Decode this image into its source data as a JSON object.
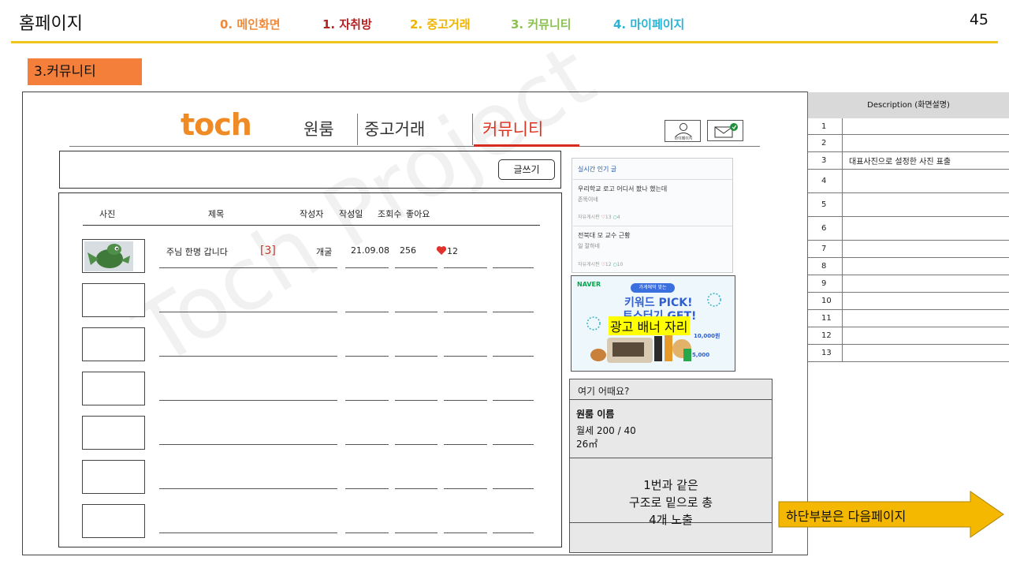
{
  "slide": {
    "title": "홈페이지",
    "page_number": "45",
    "section_tag": "3.커뮤니티",
    "nav": [
      {
        "label": "0. 메인화면",
        "color": "#f08a3a"
      },
      {
        "label": "1. 자취방",
        "color": "#b22222"
      },
      {
        "label": "2. 중고거래",
        "color": "#f0b400"
      },
      {
        "label": "3. 커뮤니티",
        "color": "#8cc152"
      },
      {
        "label": "4. 마이페이지",
        "color": "#2bb3d6"
      }
    ]
  },
  "app": {
    "logo": "toch",
    "menu": [
      "원룸",
      "중고거래",
      "커뮤니티"
    ],
    "my_button_label": "마이페이지",
    "write_button": "글쓰기"
  },
  "list": {
    "columns": [
      "사진",
      "제목",
      "작성자",
      "작성일",
      "조회수",
      "좋아요"
    ],
    "first_row": {
      "title": "주님 한명 갑니다",
      "reply_count": "[3]",
      "author": "개굴",
      "date": "21.09.08",
      "views": "256",
      "likes": "12"
    }
  },
  "popular": {
    "title": "실시간 인기 글",
    "items": [
      {
        "title": "우리학교 로고 어디서 봤나 했는데",
        "sub": "존똑이네",
        "board": "자유게시판",
        "likes": "13",
        "comments": "4"
      },
      {
        "title": "전북대 모 교수 근황",
        "sub": "일 잘하네",
        "board": "자유게시판",
        "likes": "12",
        "comments": "10"
      }
    ]
  },
  "ad": {
    "brand": "NAVER",
    "pill": "가게에딱 맞는",
    "headline1": "키워드 PICK!",
    "headline2": "토스터기 GET!",
    "label": "광고 배너 자리",
    "prize1": "10,000원",
    "prize2": "5,000"
  },
  "recommend": {
    "header": "여기 어때요?",
    "name": "원룸 이름",
    "price": "월세 200 / 40",
    "area": "26㎡",
    "note_lines": [
      "1번과 같은",
      "구조로 밑으로 총",
      "4개 노출"
    ]
  },
  "description": {
    "header": "Description (화면설명)",
    "rows": [
      {
        "num": "1",
        "text": ""
      },
      {
        "num": "2",
        "text": ""
      },
      {
        "num": "3",
        "text": "대표사진으로 설정한 사진 표출"
      },
      {
        "num": "4",
        "text": ""
      },
      {
        "num": "5",
        "text": ""
      },
      {
        "num": "6",
        "text": ""
      },
      {
        "num": "7",
        "text": ""
      },
      {
        "num": "8",
        "text": ""
      },
      {
        "num": "9",
        "text": ""
      },
      {
        "num": "10",
        "text": ""
      },
      {
        "num": "11",
        "text": ""
      },
      {
        "num": "12",
        "text": ""
      },
      {
        "num": "13",
        "text": ""
      }
    ]
  },
  "next_page_note": "하단부분은 다음페이지",
  "watermark": "Toch Project",
  "colors": {
    "accent": "#f08a24",
    "rule": "#f0c419",
    "tag": "#f47f3a",
    "active": "#e0311f",
    "arrow": "#f5b800"
  }
}
